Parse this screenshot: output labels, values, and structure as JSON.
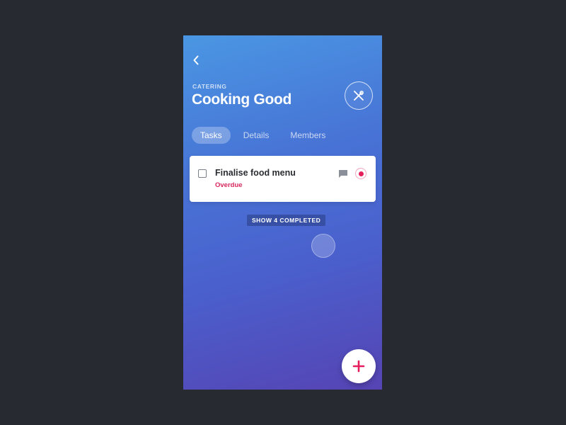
{
  "header": {
    "category": "CATERING",
    "title": "Cooking Good",
    "back_icon": "chevron-left-icon",
    "category_icon": "utensils-icon"
  },
  "tabs": [
    {
      "label": "Tasks",
      "active": true
    },
    {
      "label": "Details",
      "active": false
    },
    {
      "label": "Members",
      "active": false
    }
  ],
  "tasks": [
    {
      "title": "Finalise food menu",
      "status": "Overdue",
      "checked": false,
      "has_comment": true,
      "priority": "high"
    }
  ],
  "completed": {
    "label": "SHOW 4 COMPLETED"
  },
  "fab": {
    "icon": "plus-icon"
  },
  "colors": {
    "gradient_top": "#4a97e3",
    "gradient_bottom": "#5644b4",
    "accent": "#e51f5c",
    "overdue": "#d8295e",
    "background": "#272a30"
  }
}
